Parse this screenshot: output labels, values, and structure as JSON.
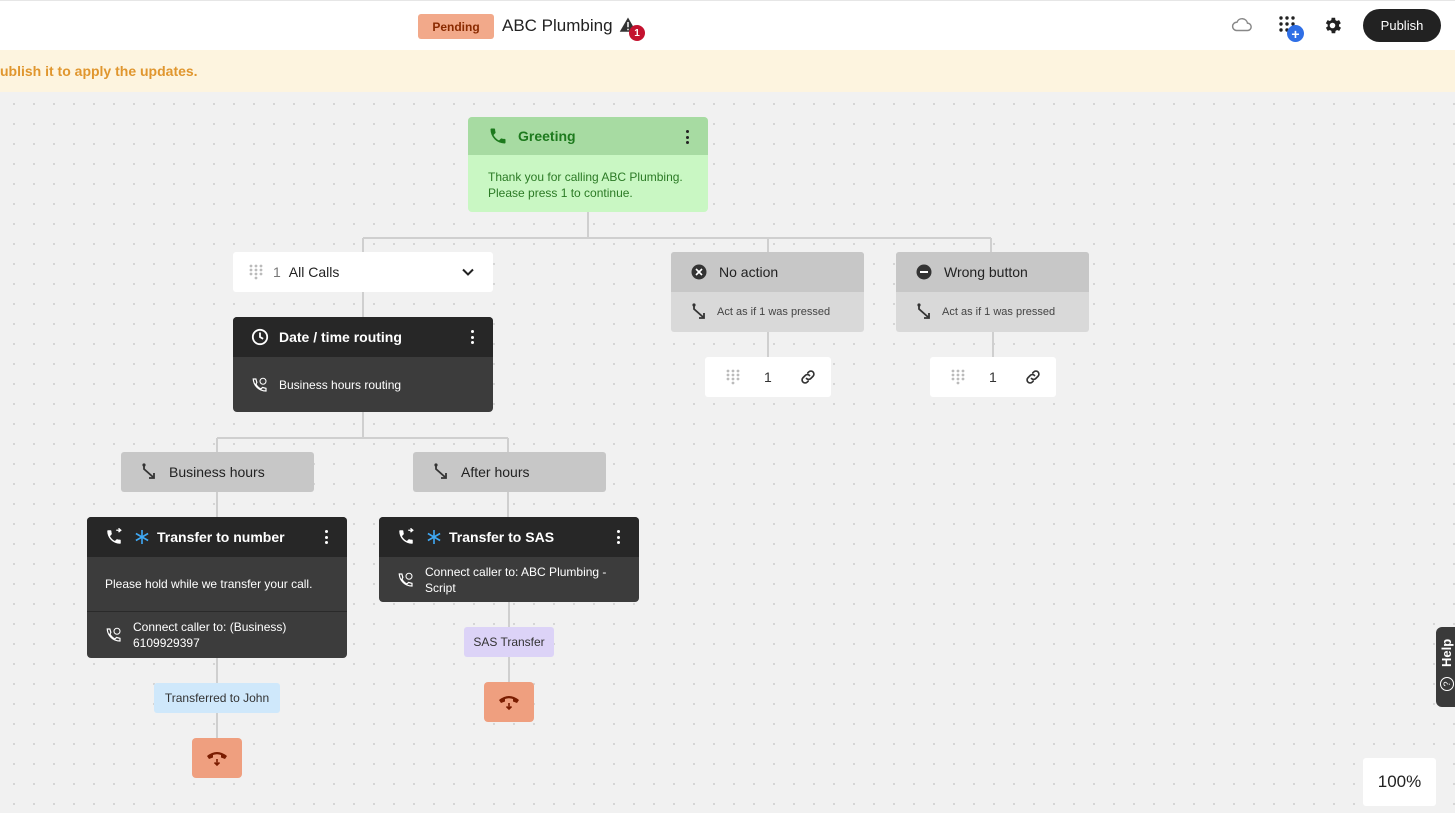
{
  "header": {
    "status_badge": "Pending",
    "flow_name": "ABC Plumbing",
    "warning_count": "1",
    "publish_label": "Publish"
  },
  "banner": {
    "text": "ublish it to apply the updates."
  },
  "nodes": {
    "greeting": {
      "title": "Greeting",
      "message": "Thank you for calling ABC Plumbing. Please press 1 to continue."
    },
    "all_calls": {
      "key": "1",
      "label": "All Calls"
    },
    "date_time": {
      "title": "Date / time routing",
      "row": "Business hours routing"
    },
    "business_hours": {
      "label": "Business hours"
    },
    "after_hours": {
      "label": "After hours"
    },
    "no_action": {
      "title": "No action",
      "sub": "Act as if 1 was pressed",
      "key": "1"
    },
    "wrong_button": {
      "title": "Wrong button",
      "sub": "Act as if 1 was pressed",
      "key": "1"
    },
    "transfer_number": {
      "title": "Transfer to number",
      "message": "Please hold while we transfer your call.",
      "connect": "Connect caller to: (Business) 6109929397",
      "tag": "Transferred to John"
    },
    "transfer_sas": {
      "title": "Transfer to SAS",
      "connect": "Connect caller to: ABC Plumbing - Script",
      "tag": "SAS Transfer"
    }
  },
  "help": {
    "label": "Help"
  },
  "zoom": {
    "level": "100%"
  },
  "colors": {
    "greeting_head": "#a7dba2",
    "greeting_body": "#c9f7c3",
    "pending": "#f2a98a",
    "banner": "#fdf4df",
    "hangup": "#ef9f7f",
    "dark_node": "#3c3c3c"
  }
}
